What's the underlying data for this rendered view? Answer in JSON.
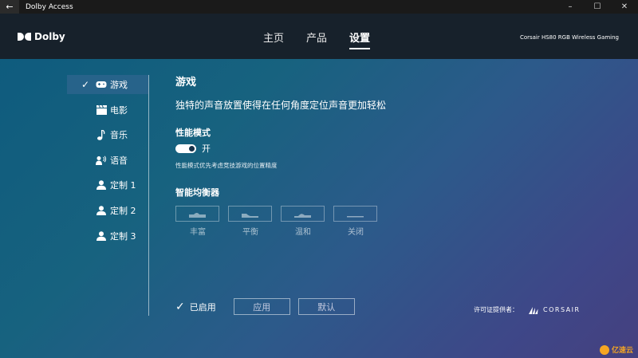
{
  "window": {
    "title": "Dolby Access",
    "controls": [
      "–",
      "☐",
      "✕"
    ]
  },
  "header": {
    "logo_text": "Dolby",
    "nav": [
      {
        "label": "主页",
        "active": false
      },
      {
        "label": "产品",
        "active": false
      },
      {
        "label": "设置",
        "active": true
      }
    ],
    "device": "Corsair HS80 RGB Wireless Gaming"
  },
  "sidebar": {
    "items": [
      {
        "label": "游戏",
        "icon": "gamepad-icon",
        "active": true
      },
      {
        "label": "电影",
        "icon": "clapperboard-icon",
        "active": false
      },
      {
        "label": "音乐",
        "icon": "music-note-icon",
        "active": false
      },
      {
        "label": "语音",
        "icon": "voice-icon",
        "active": false
      },
      {
        "label": "定制 1",
        "icon": "user-icon",
        "active": false
      },
      {
        "label": "定制 2",
        "icon": "user-icon",
        "active": false
      },
      {
        "label": "定制 3",
        "icon": "user-icon",
        "active": false
      }
    ]
  },
  "main": {
    "title": "游戏",
    "description": "独特的声音放置使得在任何角度定位声音更加轻松",
    "performance": {
      "title": "性能模式",
      "toggle_state": "开",
      "note": "性能模式优先考虑竞技游戏的位置精度"
    },
    "equalizer": {
      "title": "智能均衡器",
      "presets": [
        "丰富",
        "平衡",
        "温和",
        "关闭"
      ]
    }
  },
  "footer": {
    "enabled_label": "已启用",
    "apply_label": "应用",
    "default_label": "默认",
    "license_label": "许可证提供者：",
    "brand": "CORSAIR"
  },
  "watermark": "亿速云"
}
